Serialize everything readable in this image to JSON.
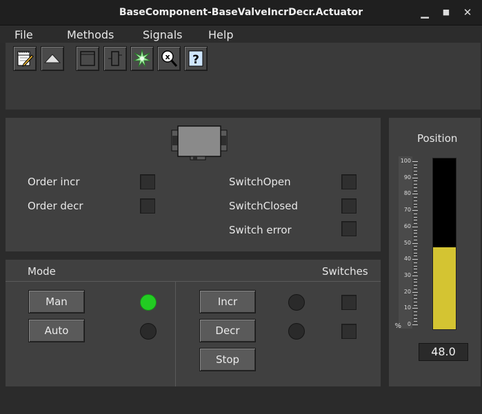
{
  "window": {
    "title": "BaseComponent-BaseValveIncrDecr.Actuator",
    "minimize": "▁",
    "maximize": "■",
    "close": "✕"
  },
  "menu": [
    "File",
    "Methods",
    "Signals",
    "Help"
  ],
  "toolbar": [
    {
      "icon": "notepad-pen-icon"
    },
    {
      "icon": "triangle-up-icon"
    },
    {
      "icon": "window-icon"
    },
    {
      "icon": "component-icon"
    },
    {
      "icon": "crossref-star-icon"
    },
    {
      "icon": "zoom-x-icon"
    },
    {
      "icon": "help-icon"
    }
  ],
  "status": {
    "order_incr": "Order incr",
    "order_decr": "Order decr",
    "switch_open": "SwitchOpen",
    "switch_closed": "SwitchClosed",
    "switch_error": "Switch error"
  },
  "mode": {
    "title": "Mode",
    "switches_title": "Switches",
    "man": "Man",
    "auto": "Auto",
    "man_led": "on",
    "auto_led": "off",
    "incr": "Incr",
    "decr": "Decr",
    "stop": "Stop"
  },
  "position": {
    "title": "Position",
    "value": 48.0,
    "value_text": "48.0",
    "unit": "%",
    "scale_labels": [
      "100",
      "90",
      "80",
      "70",
      "60",
      "50",
      "40",
      "30",
      "20",
      "10",
      "0"
    ],
    "bar_color": "#d4c432",
    "range": [
      0,
      100
    ]
  },
  "help_glyph": "?"
}
